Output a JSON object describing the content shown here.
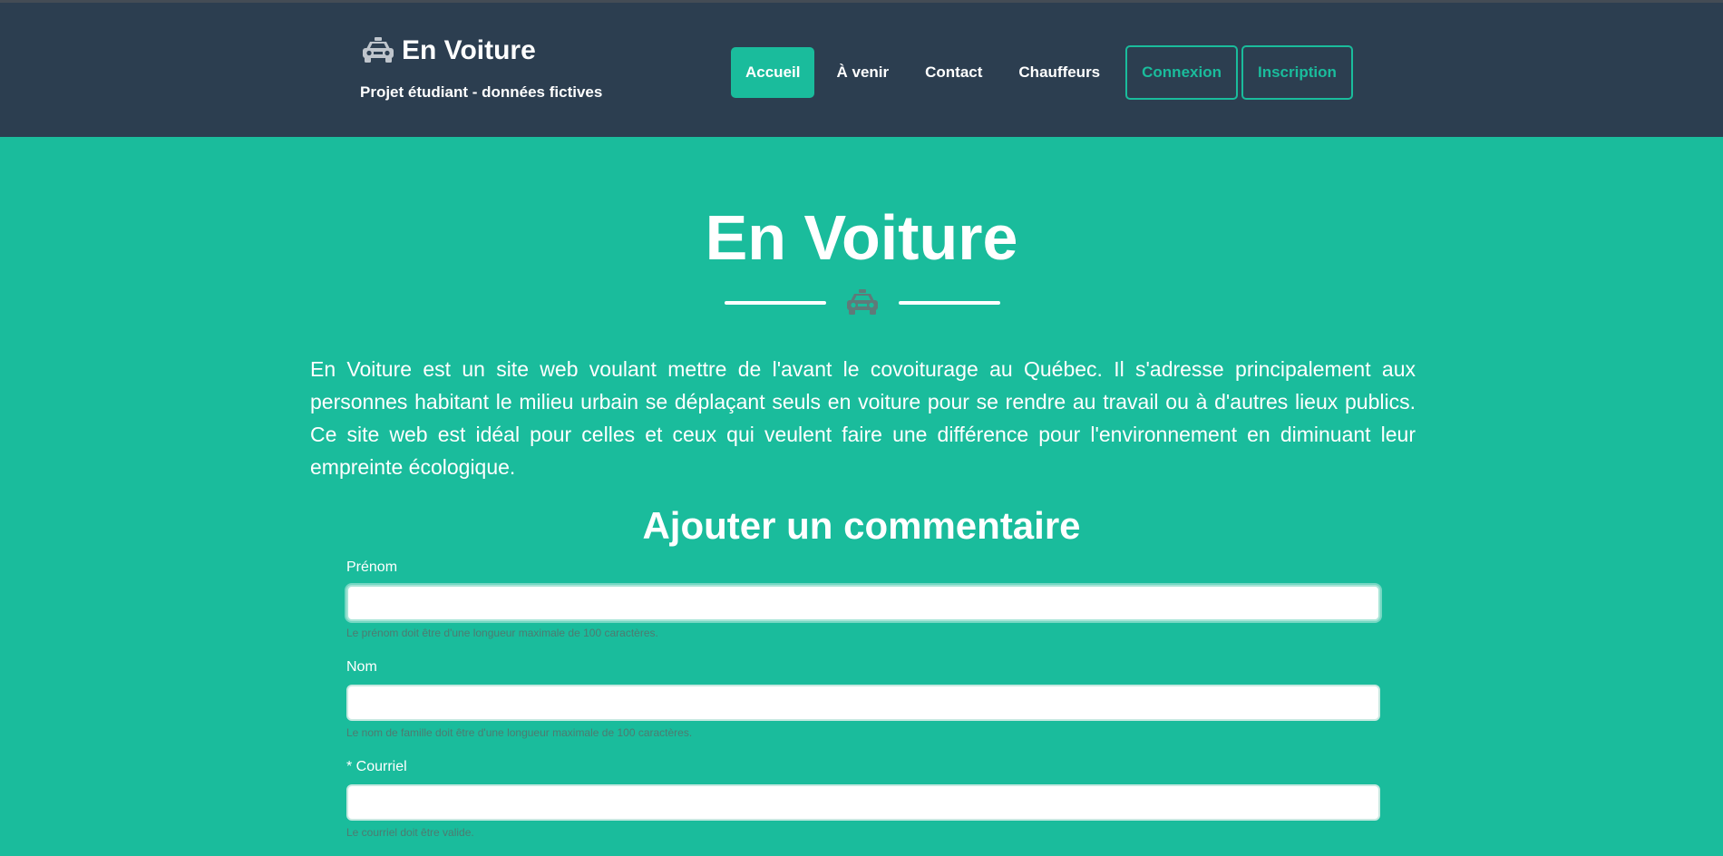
{
  "colors": {
    "navbar": "#2c3e50",
    "accent": "#1abc9c",
    "text": "#ffffff",
    "hint": "#4e7a70"
  },
  "brand": {
    "icon": "car-icon",
    "title": "En Voiture",
    "subtitle": "Projet étudiant - données fictives"
  },
  "nav": {
    "items": [
      {
        "label": "Accueil",
        "active": true
      },
      {
        "label": "À venir",
        "active": false
      },
      {
        "label": "Contact",
        "active": false
      },
      {
        "label": "Chauffeurs",
        "active": false
      }
    ],
    "login": "Connexion",
    "signup": "Inscription"
  },
  "hero": {
    "title": "En Voiture",
    "divider_icon": "car-icon",
    "intro": "En Voiture est un site web voulant mettre de l'avant le covoiturage au Québec. Il s'adresse principalement aux personnes habitant le milieu urbain se déplaçant seuls en voiture pour se rendre au travail ou à d'autres lieux publics. Ce site web est idéal pour celles et ceux qui veulent faire une différence pour l'environnement en diminuant leur empreinte écologique."
  },
  "form": {
    "title": "Ajouter un commentaire",
    "fields": [
      {
        "label": "Prénom",
        "value": "",
        "hint": "Le prénom doit être d'une longueur maximale de 100 caractères."
      },
      {
        "label": "Nom",
        "value": "",
        "hint": "Le nom de famille doit être d'une longueur maximale de 100 caractères."
      },
      {
        "label": "* Courriel",
        "value": "",
        "hint": "Le courriel doit être valide."
      }
    ]
  }
}
